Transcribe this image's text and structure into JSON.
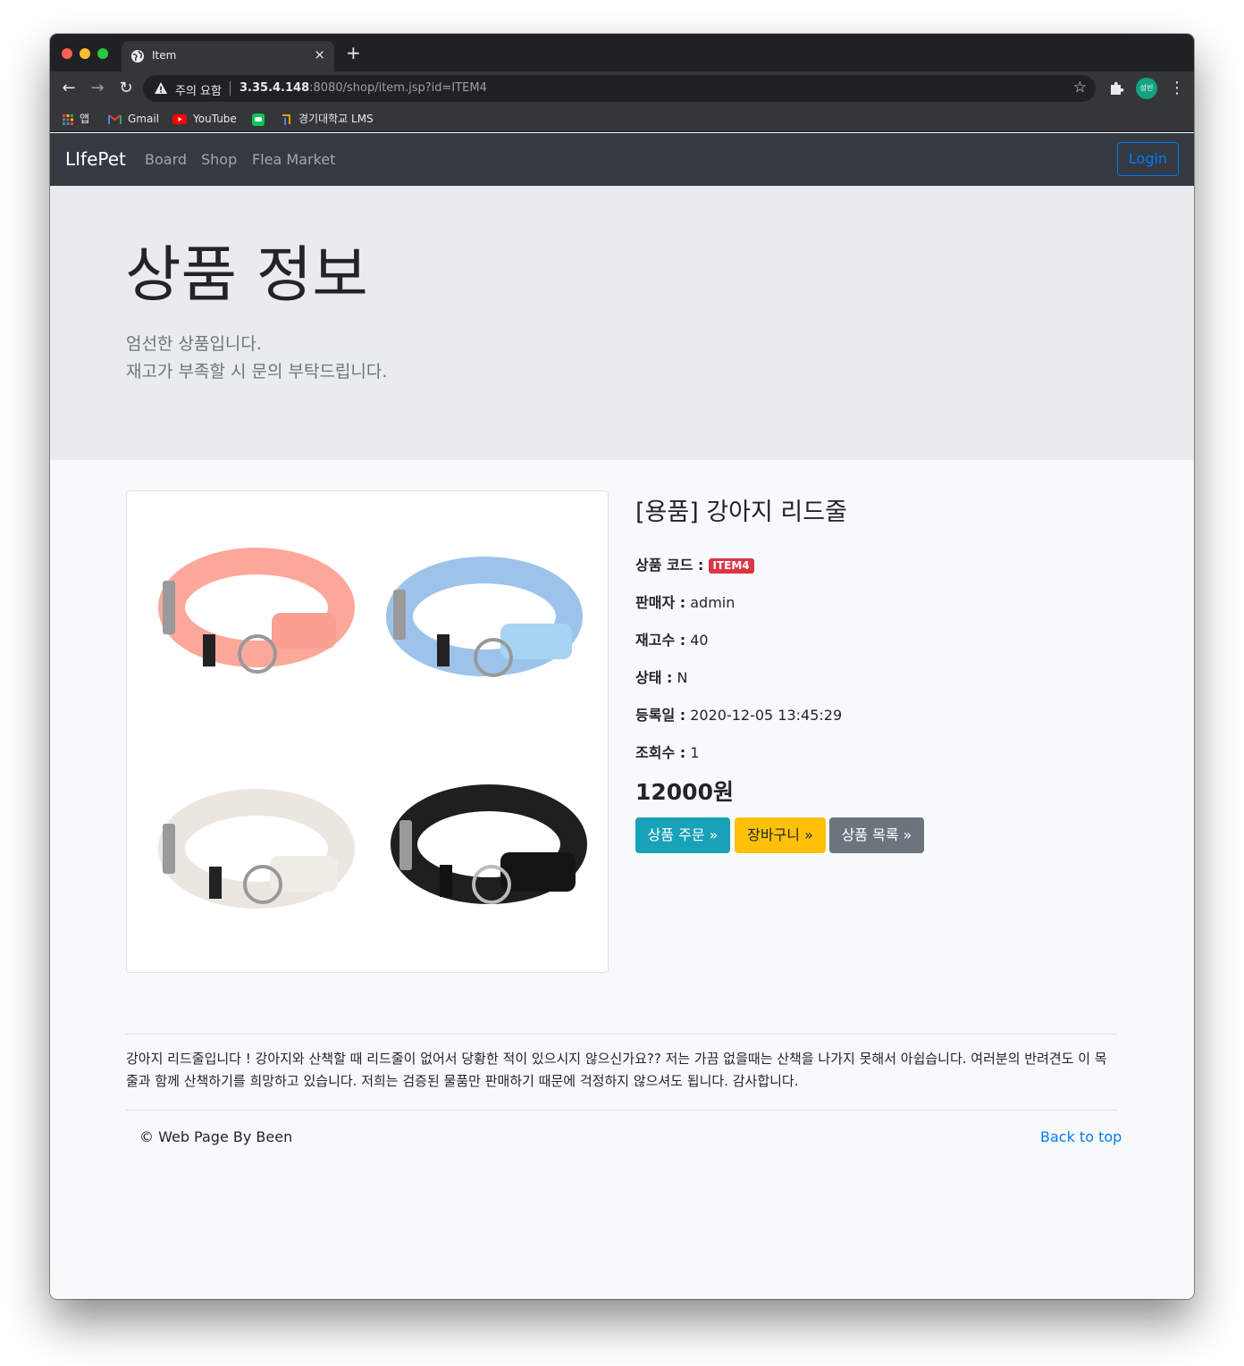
{
  "browser": {
    "tab_title": "Item",
    "tab_close": "×",
    "new_tab": "+",
    "security_label": "주의 요함",
    "url_host": "3.35.4.148",
    "url_rest": ":8080/shop/item.jsp?id=ITEM4",
    "profile_initials": "성빈",
    "bookmarks": [
      {
        "label": "앱",
        "icon": "apps-grid-icon"
      },
      {
        "label": "Gmail",
        "icon": "gmail-icon"
      },
      {
        "label": "YouTube",
        "icon": "youtube-icon"
      },
      {
        "label": "",
        "icon": "line-chat-icon"
      },
      {
        "label": "경기대학교 LMS",
        "icon": "lms-icon"
      }
    ]
  },
  "navbar": {
    "brand": "LIfePet",
    "links": [
      "Board",
      "Shop",
      "Flea Market"
    ],
    "login": "Login"
  },
  "jumbotron": {
    "title": "상품 정보",
    "line1": "엄선한 상품입니다.",
    "line2": "재고가 부족할 시 문의 부탁드립니다."
  },
  "product": {
    "name": "[용품] 강아지 리드줄",
    "code_label": "상품 코드 :",
    "code": "ITEM4",
    "seller_label": "판매자 :",
    "seller": "admin",
    "stock_label": "재고수 :",
    "stock": "40",
    "condition_label": "상태 :",
    "condition": "N",
    "date_label": "등록일 :",
    "date": "2020-12-05 13:45:29",
    "views_label": "조회수 :",
    "views": "1",
    "price": "12000원",
    "image_colors": [
      "#fba89a",
      "#9cc4ea",
      "#ebe7e0",
      "#1f1f1f"
    ]
  },
  "buttons": {
    "order": "상품 주문 »",
    "cart": "장바구니 »",
    "list": "상품 목록 »"
  },
  "description": "강아지 리드줄입니다 ! 강아지와 산책할 때 리드줄이 없어서 당황한 적이 있으시지 않으신가요?? 저는 가끔 없을때는 산책을 나가지 못해서 아쉽습니다. 여러분의 반려견도 이 목줄과 함께 산책하기를 희망하고 있습니다. 저희는 검증된 물품만 판매하기 때문에 걱정하지 않으셔도 됩니다. 감사합니다.",
  "footer": {
    "copyright": "© Web Page By Been",
    "back_to_top": "Back to top"
  }
}
